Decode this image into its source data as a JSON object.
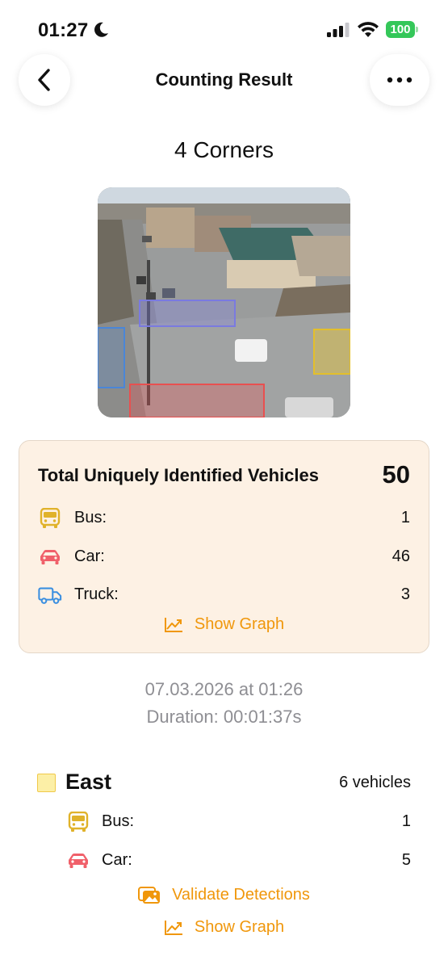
{
  "status_bar": {
    "time": "01:27",
    "battery": "100"
  },
  "nav": {
    "title": "Counting Result"
  },
  "camera": {
    "name": "4 Corners"
  },
  "summary": {
    "title": "Total Uniquely Identified Vehicles",
    "total": "50",
    "rows": [
      {
        "label": "Bus:",
        "value": "1",
        "icon": "bus-icon",
        "color": "#e0b22a"
      },
      {
        "label": "Car:",
        "value": "46",
        "icon": "car-icon",
        "color": "#f0606a"
      },
      {
        "label": "Truck:",
        "value": "3",
        "icon": "truck-icon",
        "color": "#3b8fe0"
      }
    ],
    "show_graph_label": "Show Graph"
  },
  "meta": {
    "datetime": "07.03.2026 at 01:26",
    "duration": "Duration: 00:01:37s"
  },
  "section_east": {
    "name": "East",
    "count": "6 vehicles",
    "swatch_color": "#fcefa6",
    "rows": [
      {
        "label": "Bus:",
        "value": "1",
        "icon": "bus-icon"
      },
      {
        "label": "Car:",
        "value": "5",
        "icon": "car-icon"
      }
    ],
    "validate_label": "Validate Detections",
    "show_graph_label": "Show Graph"
  },
  "colors": {
    "accent": "#f0970b",
    "card_bg": "#fdf1e4",
    "bus": "#e0b22a",
    "car": "#f0606a",
    "truck": "#3b8fe0"
  }
}
